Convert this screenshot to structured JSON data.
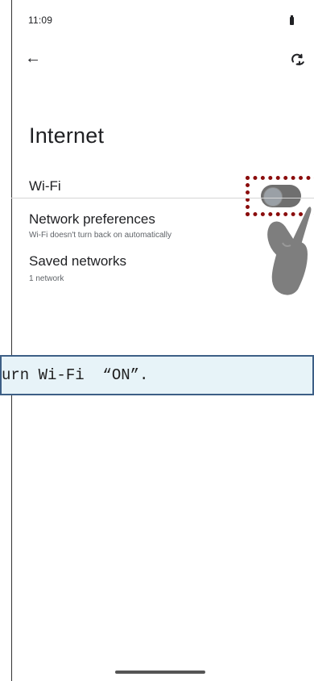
{
  "status_bar": {
    "time": "11:09"
  },
  "header": {
    "back_icon": "arrow-left-icon",
    "refresh_icon": "refresh-icon"
  },
  "page": {
    "title": "Internet"
  },
  "settings": {
    "wifi": {
      "label": "Wi-Fi",
      "enabled": false
    },
    "network_preferences": {
      "title": "Network preferences",
      "subtitle": "Wi-Fi doesn't turn back on automatically"
    },
    "saved_networks": {
      "title": "Saved networks",
      "subtitle": "1 network"
    }
  },
  "overlay": {
    "instruction": "urn Wi-Fi  “ON”.",
    "highlight_color": "#8b0d0d",
    "banner_color": "#e7f3f8"
  }
}
